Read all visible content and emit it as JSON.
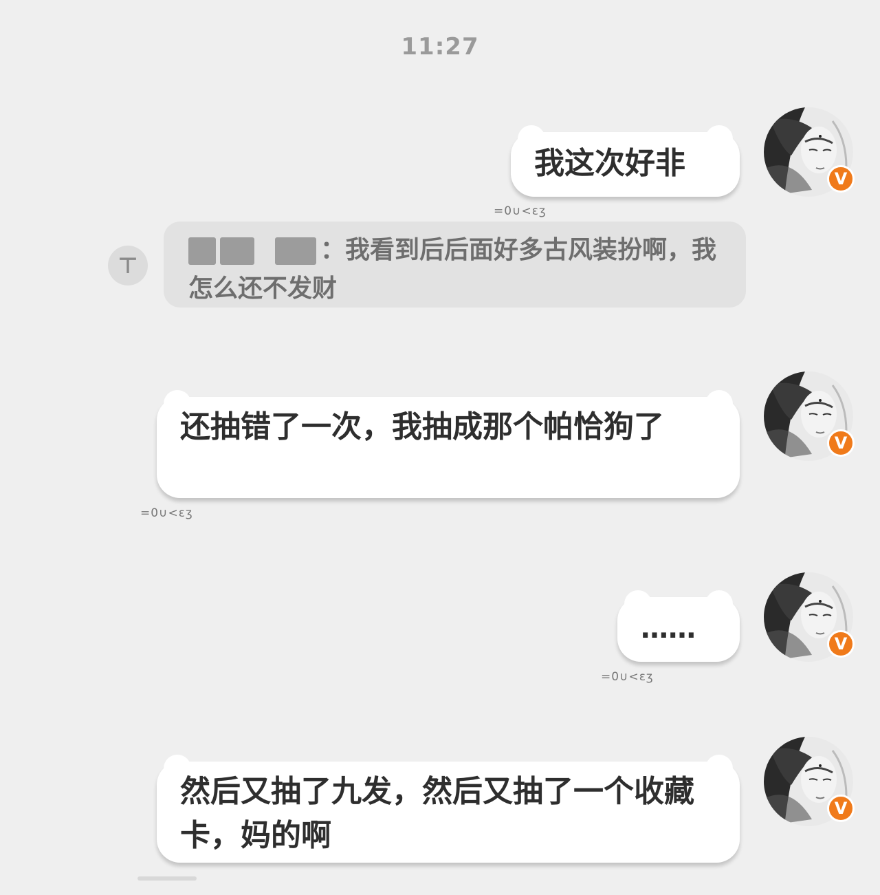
{
  "chat": {
    "timestamp": "11:27",
    "verified_badge": "V",
    "kaomoji": "=0∪<εʒ",
    "messages": [
      {
        "text": "我这次好非"
      },
      {
        "text": "还抽错了一次，我抽成那个帕恰狗了"
      },
      {
        "text": "……"
      },
      {
        "text": "然后又抽了九发，然后又抽了一个收藏卡，妈的啊"
      }
    ],
    "quote": {
      "visible_text": "：我看到后后面好多古风装扮啊，我怎么还不发财",
      "icon": "arrow-up-to-top-icon"
    }
  },
  "colors": {
    "background": "#efefef",
    "bubble": "#ffffff",
    "quote_background": "#e2e2e2",
    "badge": "#f07a1a",
    "timestamp": "#9a9a9a"
  }
}
